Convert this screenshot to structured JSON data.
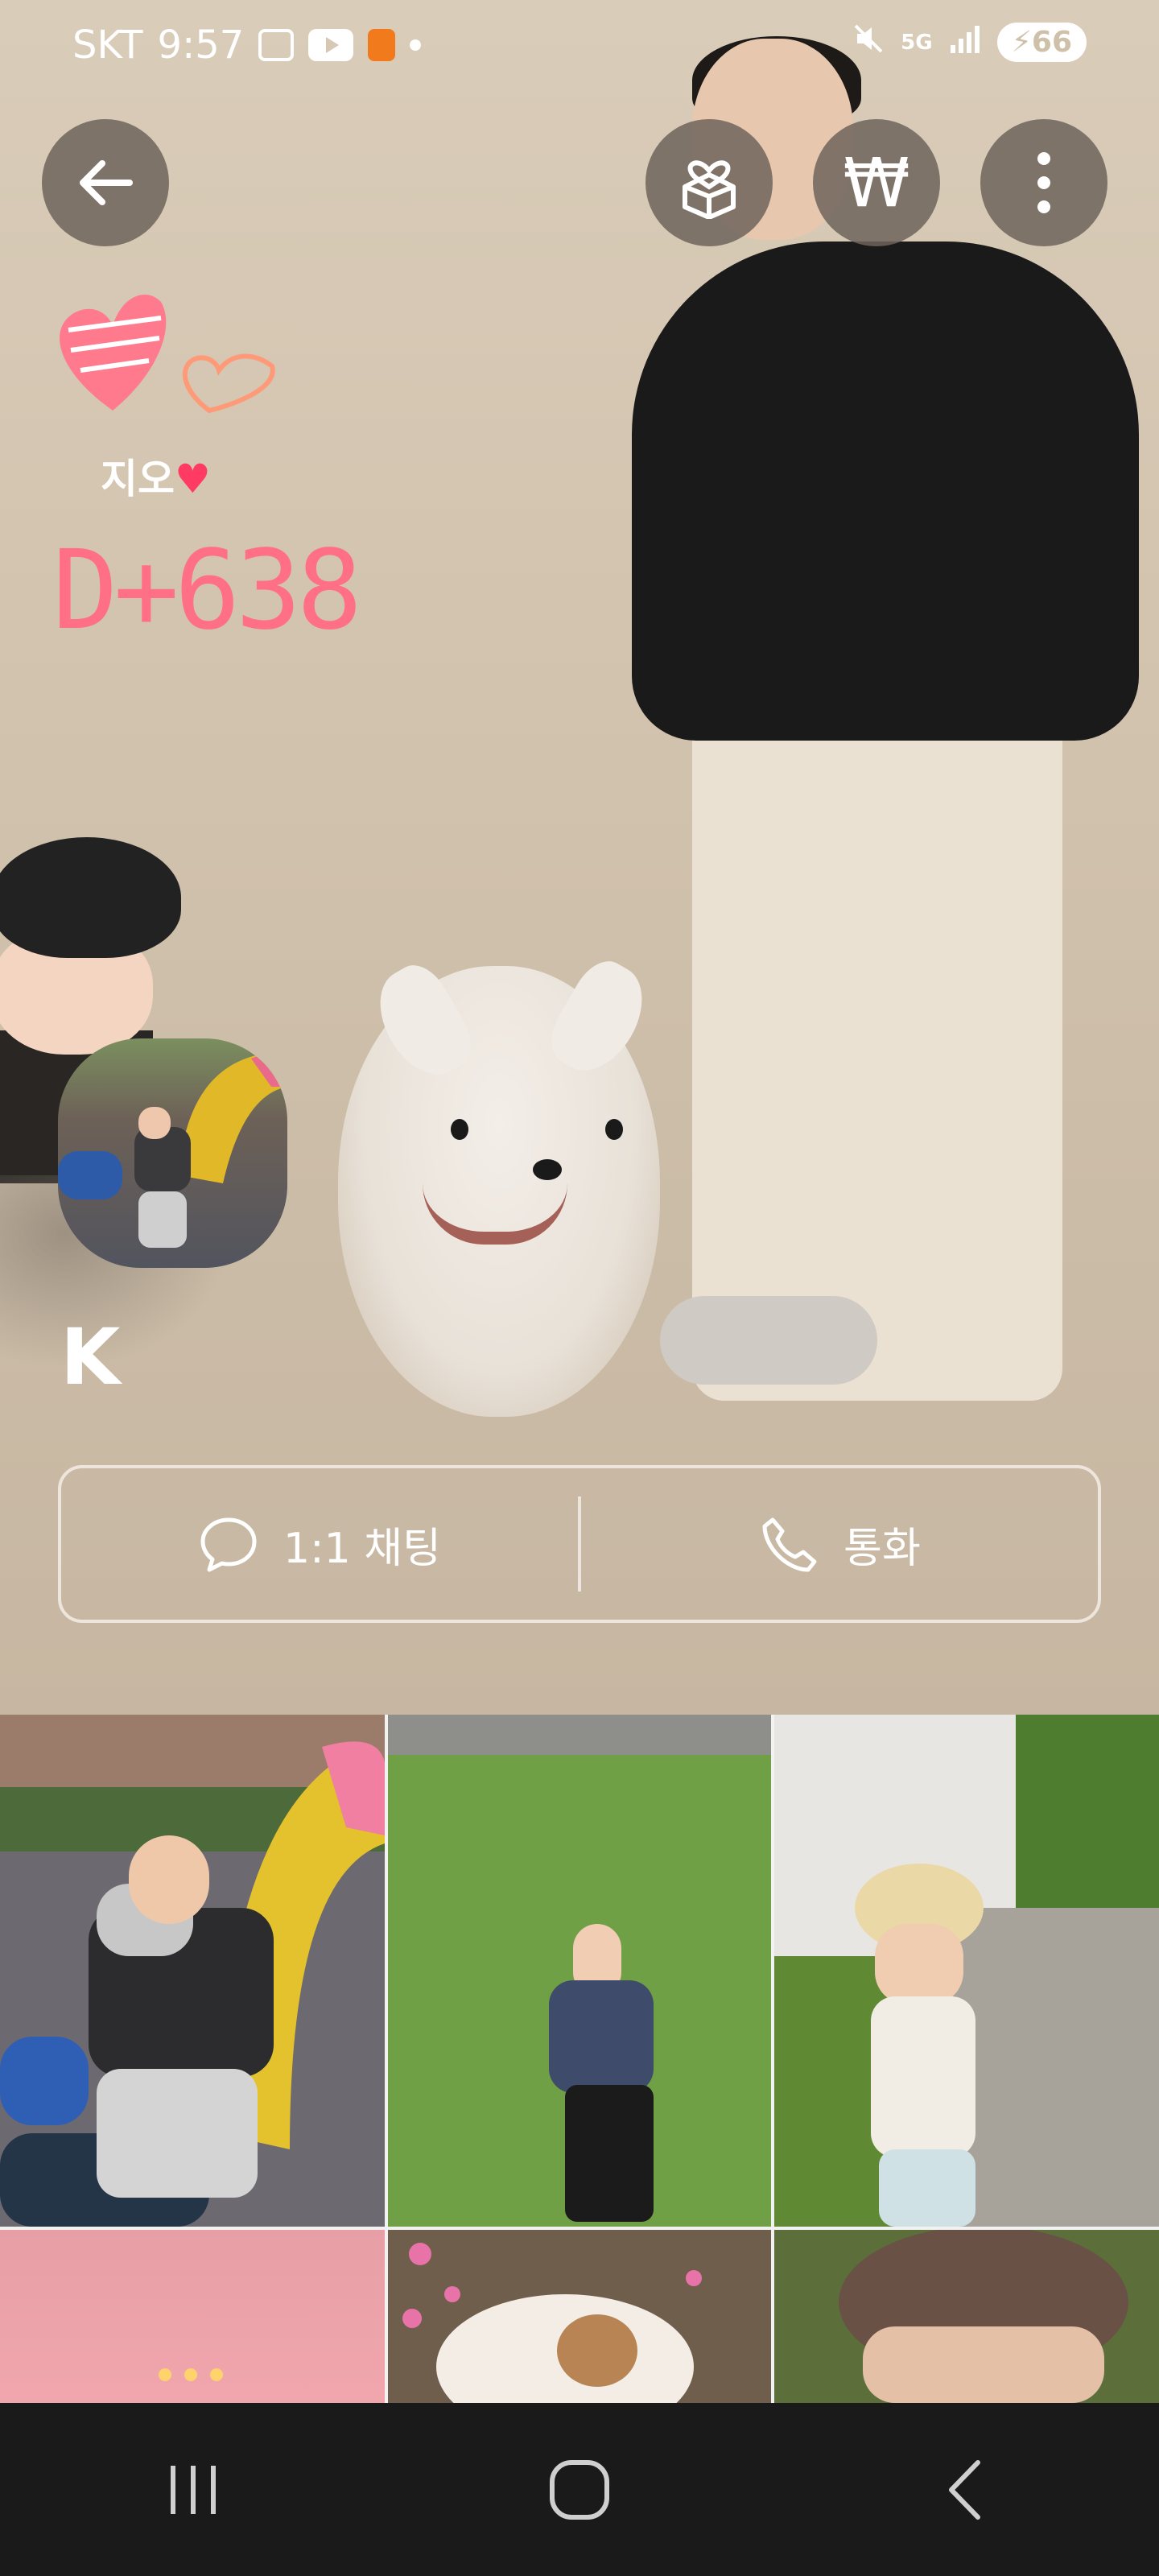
{
  "status_bar": {
    "carrier": "SKT",
    "time": "9:57",
    "network": "5G",
    "battery": "66"
  },
  "profile": {
    "tag_name": "지오",
    "dday": "D+638",
    "initial": "K"
  },
  "actions": {
    "chat_label": "1:1 채팅",
    "call_label": "통화"
  },
  "icons": {
    "back": "back-arrow-icon",
    "gift": "gift-icon",
    "money": "won-icon",
    "more": "more-vertical-icon",
    "chat": "chat-bubble-icon",
    "call": "phone-icon"
  },
  "colors": {
    "dday": "#ff6f85",
    "button_bg": "#6e645c"
  }
}
